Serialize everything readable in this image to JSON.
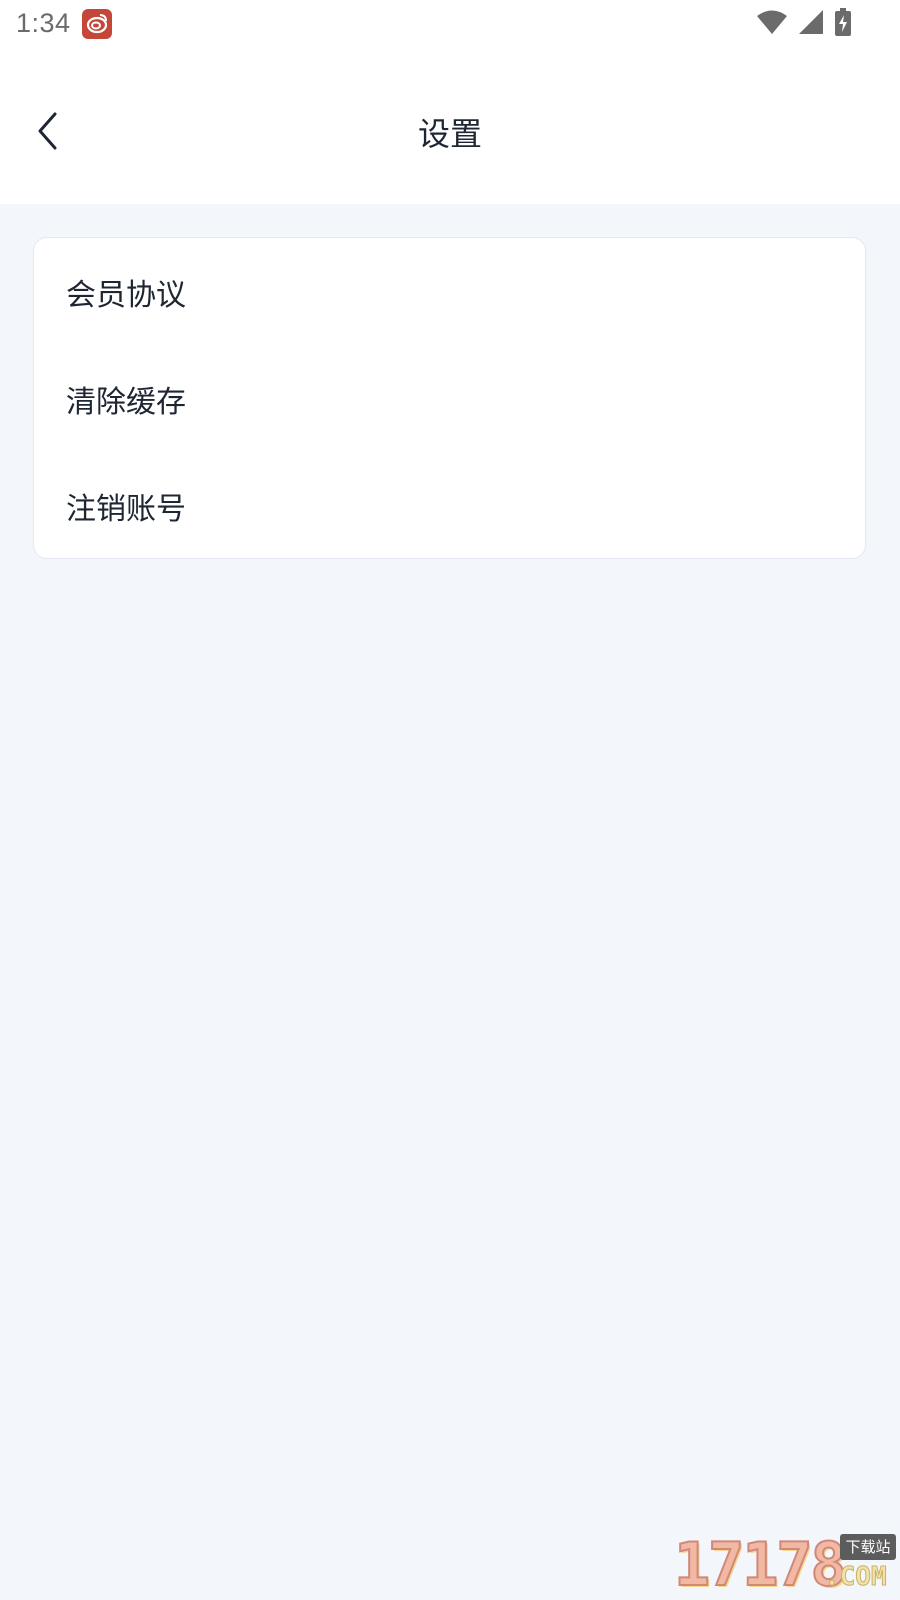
{
  "status_bar": {
    "time": "1:34",
    "app_icon": "weibo-like-app-icon",
    "wifi_icon": "wifi-icon",
    "signal_icon": "signal-icon",
    "battery_icon": "battery-charging-icon"
  },
  "header": {
    "back_icon": "chevron-left-icon",
    "title": "设置"
  },
  "settings": {
    "items": [
      {
        "label": "会员协议"
      },
      {
        "label": "清除缓存"
      },
      {
        "label": "注销账号"
      }
    ]
  },
  "watermark": {
    "digits": "17178",
    "badge": "下载站",
    "suffix": ".COM"
  },
  "colors": {
    "page_background": "#f3f6fb",
    "card_background": "#ffffff",
    "text_primary": "#1f2633",
    "status_text": "#6b6b6b",
    "app_icon": "#c4473a"
  }
}
